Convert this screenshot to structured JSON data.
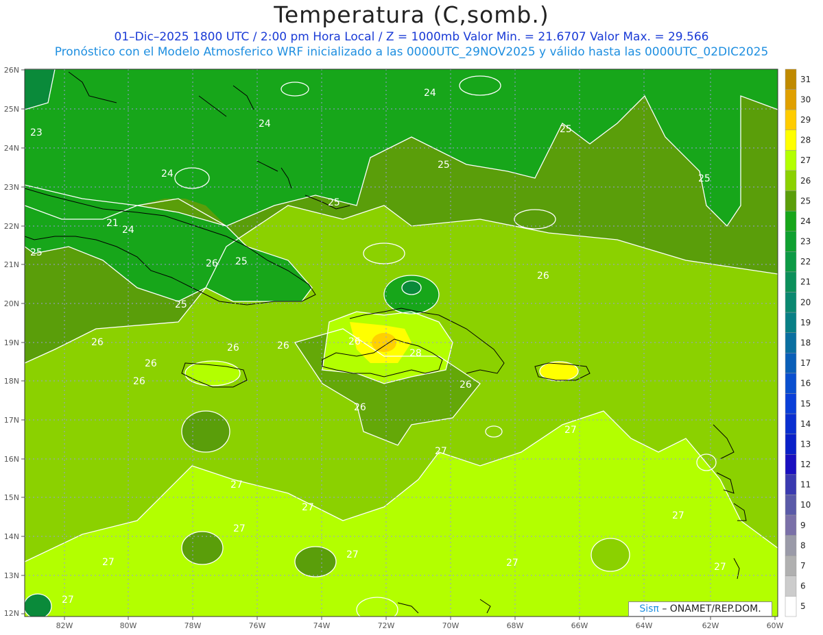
{
  "header": {
    "title": "Temperatura (C,somb.)",
    "subtitle1": "01–Dic–2025  1800 UTC / 2:00 pm Hora Local / Z = 1000mb     Valor Min. = 21.6707  Valor Max. = 29.566",
    "subtitle2": "Pronóstico con el Modelo Atmosferico WRF inicializado a las 0000UTC_29NOV2025 y válido hasta las  0000UTC_02DIC2025"
  },
  "map": {
    "lat_labels": [
      "26N",
      "25N",
      "24N",
      "23N",
      "22N",
      "21N",
      "20N",
      "19N",
      "18N",
      "17N",
      "16N",
      "15N",
      "14N",
      "13N",
      "12N"
    ],
    "lon_labels": [
      "82W",
      "80W",
      "78W",
      "76W",
      "74W",
      "72W",
      "70W",
      "68W",
      "66W",
      "64W",
      "62W",
      "60W"
    ],
    "contour_labels": [
      "23",
      "24",
      "24",
      "24",
      "25",
      "25",
      "25",
      "25",
      "25",
      "25",
      "25",
      "26",
      "26",
      "26",
      "26",
      "26",
      "26",
      "26",
      "26",
      "26",
      "26",
      "27",
      "27",
      "27",
      "27",
      "27",
      "27",
      "27",
      "27",
      "27",
      "27",
      "28",
      "27",
      "21",
      "24"
    ],
    "colors": {
      "c23": "#0a8a3a",
      "c24": "#17a61a",
      "c25": "#5a9e0a",
      "c26": "#8bd100",
      "c27": "#b3ff00",
      "c28": "#ffff00",
      "c29": "#ffd000"
    }
  },
  "colorbar": {
    "levels": [
      "31",
      "30",
      "29",
      "28",
      "27",
      "26",
      "25",
      "24",
      "23",
      "22",
      "21",
      "20",
      "19",
      "18",
      "17",
      "16",
      "15",
      "14",
      "13",
      "12",
      "11",
      "10",
      "9",
      "8",
      "7",
      "6",
      "5"
    ],
    "colors": [
      "#c08a00",
      "#e0a000",
      "#ffcc00",
      "#ffff00",
      "#b3ff00",
      "#8bd100",
      "#5a9e0a",
      "#17a61a",
      "#0fa030",
      "#0c9a45",
      "#0b8f5a",
      "#0a8870",
      "#087f85",
      "#0a6fa0",
      "#0a5fb8",
      "#0a4fcf",
      "#0a3fd8",
      "#0a2fd0",
      "#0a20c8",
      "#1a10c0",
      "#3a3ab0",
      "#5a5aa8",
      "#7a70a8",
      "#9a9aa8",
      "#b0b0b0",
      "#cccccc",
      "#ffffff"
    ]
  },
  "credit": {
    "sis": "Sisπ",
    "text": "– ONAMET/REP.DOM."
  }
}
